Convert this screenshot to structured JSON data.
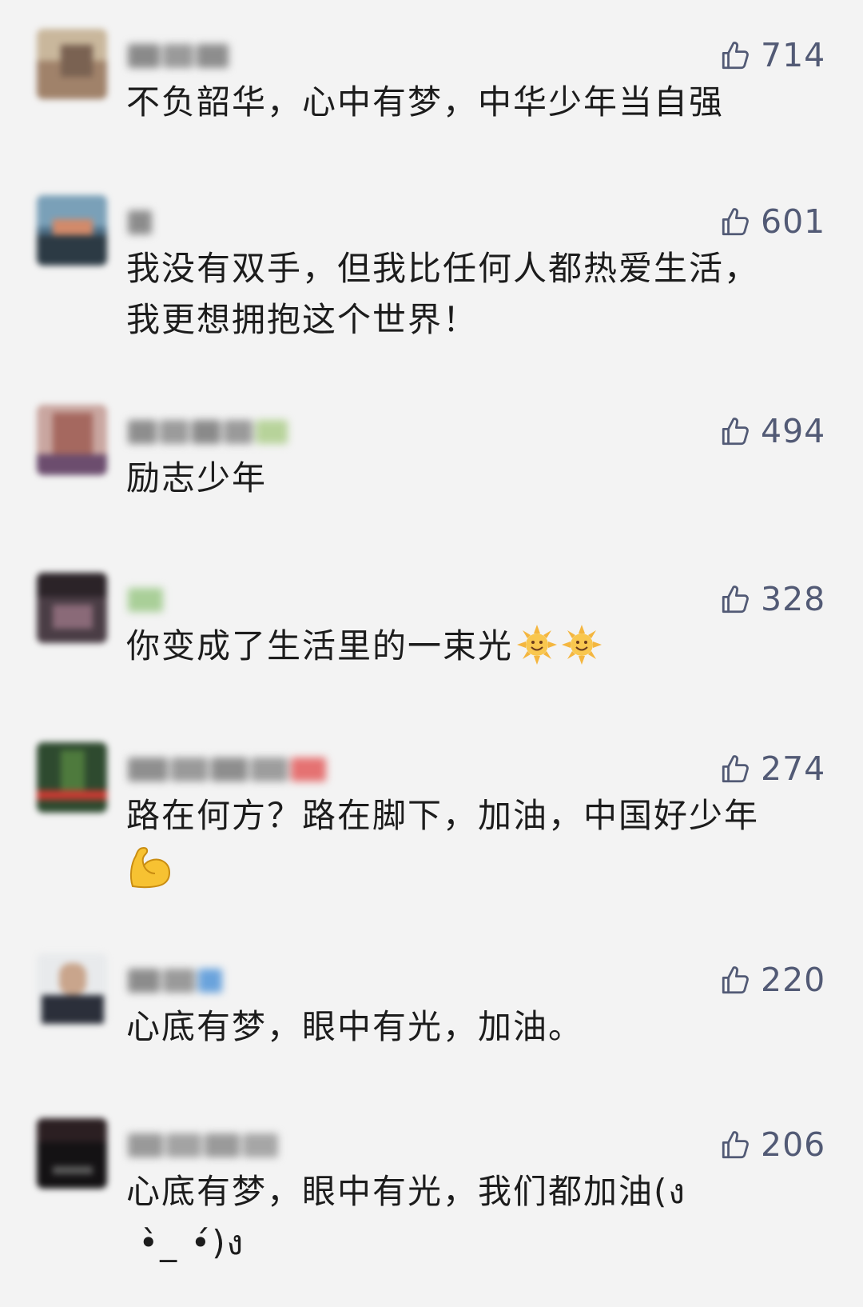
{
  "comments": [
    {
      "likes": "714",
      "text": "不负韶华，心中有梦，中华少年当自强",
      "emojis": []
    },
    {
      "likes": "601",
      "text": "我没有双手，但我比任何人都热爱生活，\n我更想拥抱这个世界！",
      "emojis": []
    },
    {
      "likes": "494",
      "text": "励志少年",
      "emojis": []
    },
    {
      "likes": "328",
      "text": "你变成了生活里的一束光",
      "emojis": [
        "sun-emoji",
        "sun-emoji"
      ]
    },
    {
      "likes": "274",
      "text": "路在何方？路在脚下，加油，中国好少年\n",
      "emojis": [
        "flexed-biceps-emoji"
      ]
    },
    {
      "likes": "220",
      "text": "心底有梦，眼中有光，加油。",
      "emojis": []
    },
    {
      "likes": "206",
      "text": "心底有梦，眼中有光，我们都加油(ง\n •̀_ •́)ง",
      "emojis": []
    }
  ],
  "icons": {
    "like": "thumbs-up-icon"
  },
  "colors": {
    "background": "#f3f3f3",
    "like_color": "#525a75",
    "text_color": "#1c1c1c"
  }
}
